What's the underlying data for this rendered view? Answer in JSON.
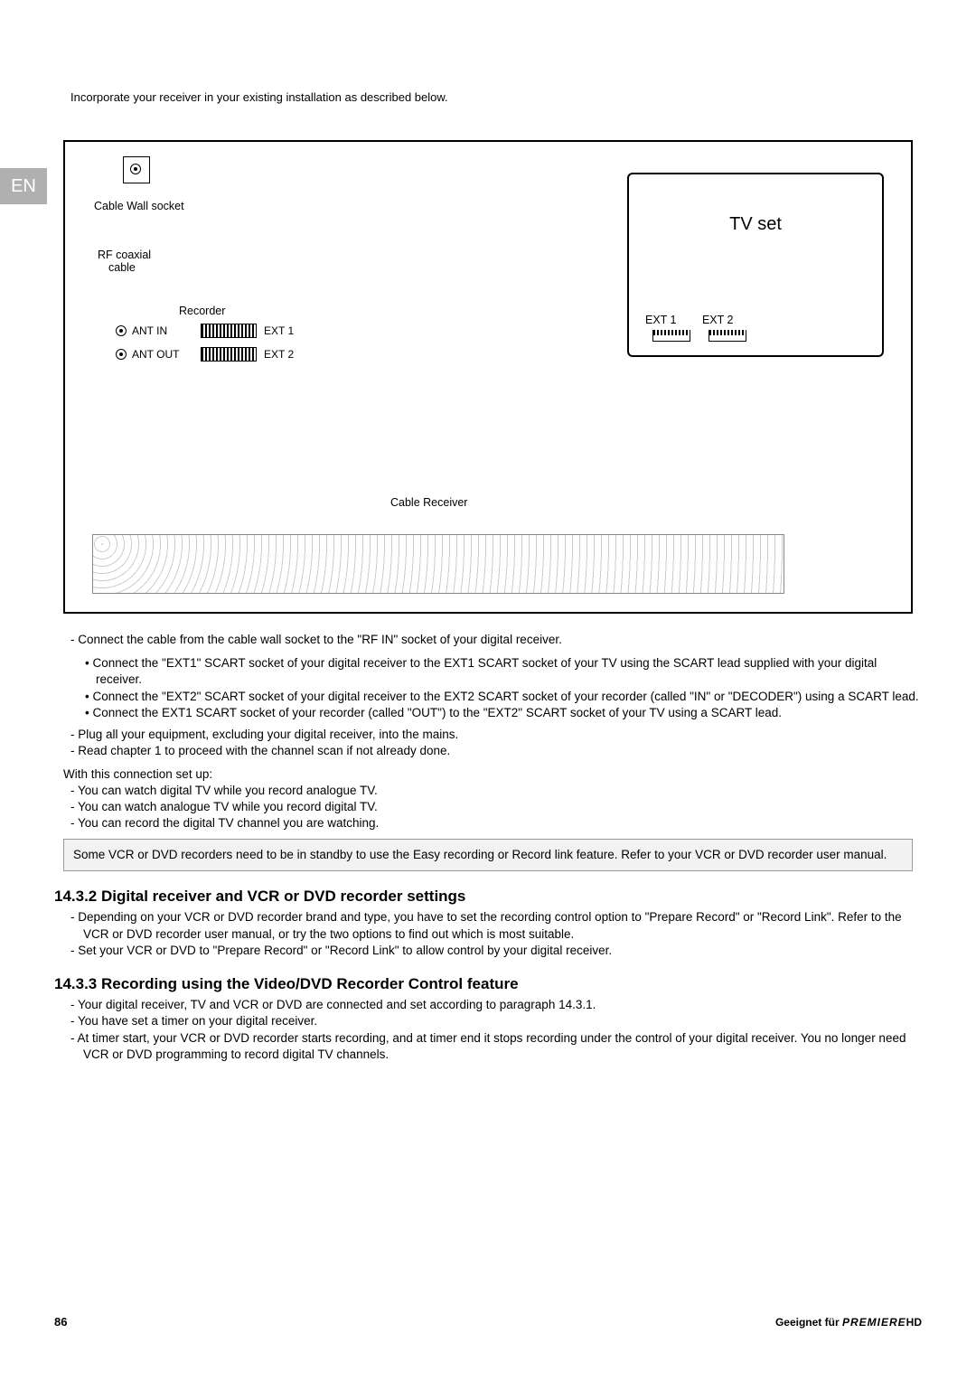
{
  "langTab": "EN",
  "intro": "Incorporate your receiver in your existing installation as described below.",
  "figure": {
    "cableWall": "Cable Wall socket",
    "rfCable1": "RF coaxial",
    "rfCable2": "cable",
    "recorder": "Recorder",
    "antIn": "ANT IN",
    "antOut": "ANT OUT",
    "ext1": "EXT 1",
    "ext2": "EXT 2",
    "tvset": "TV set",
    "tvExt1": "EXT 1",
    "tvExt2": "EXT 2",
    "cableReceiver": "Cable Receiver"
  },
  "block1": {
    "d1": "Connect the cable from the cable wall socket to the \"RF IN\" socket of your digital receiver.",
    "b1": "Connect the \"EXT1\" SCART socket of your digital receiver to the EXT1 SCART socket of your TV using the SCART lead supplied with your digital receiver.",
    "b2": "Connect the \"EXT2\" SCART socket of your digital receiver to the EXT2 SCART socket of your recorder (called \"IN\" or \"DECODER\") using a SCART lead.",
    "b3": "Connect the EXT1 SCART socket of your recorder (called \"OUT\") to the \"EXT2\" SCART socket of your TV using a SCART lead.",
    "d2": "Plug all your equipment, excluding your digital receiver, into the mains.",
    "d3": "Read chapter 1 to proceed with the channel scan if not already done.",
    "with": "With this connection set up:",
    "w1": "You can watch digital TV while you record analogue TV.",
    "w2": "You can watch analogue TV while you record digital TV.",
    "w3": "You can record the digital TV channel you are watching."
  },
  "note": "Some VCR or DVD recorders need to be in standby to use the Easy recording or Record link feature. Refer to your VCR or DVD recorder user manual.",
  "sec2": {
    "h": "14.3.2 Digital receiver and VCR or DVD recorder settings",
    "d1": "Depending on your VCR or DVD recorder brand and type, you have to set the recording control option to \"Prepare Record\" or \"Record Link\". Refer to the VCR or DVD recorder user manual, or try the two options to find out which is most suitable.",
    "d2": "Set your VCR or DVD to \"Prepare Record\" or \"Record Link\" to allow control by your digital receiver."
  },
  "sec3": {
    "h": "14.3.3 Recording using the Video/DVD Recorder Control feature",
    "d1": "Your digital receiver, TV and VCR or DVD are connected and set according to paragraph 14.3.1.",
    "d2": "You have set a timer on your digital receiver.",
    "d3": "At timer start, your VCR or DVD recorder starts recording, and at timer end it stops recording under the control of your digital receiver. You no longer need VCR or DVD programming to record digital TV channels."
  },
  "footer": {
    "page": "86",
    "geeignet": "Geeignet für",
    "brand": "PREMIERE",
    "hd": "HD"
  }
}
